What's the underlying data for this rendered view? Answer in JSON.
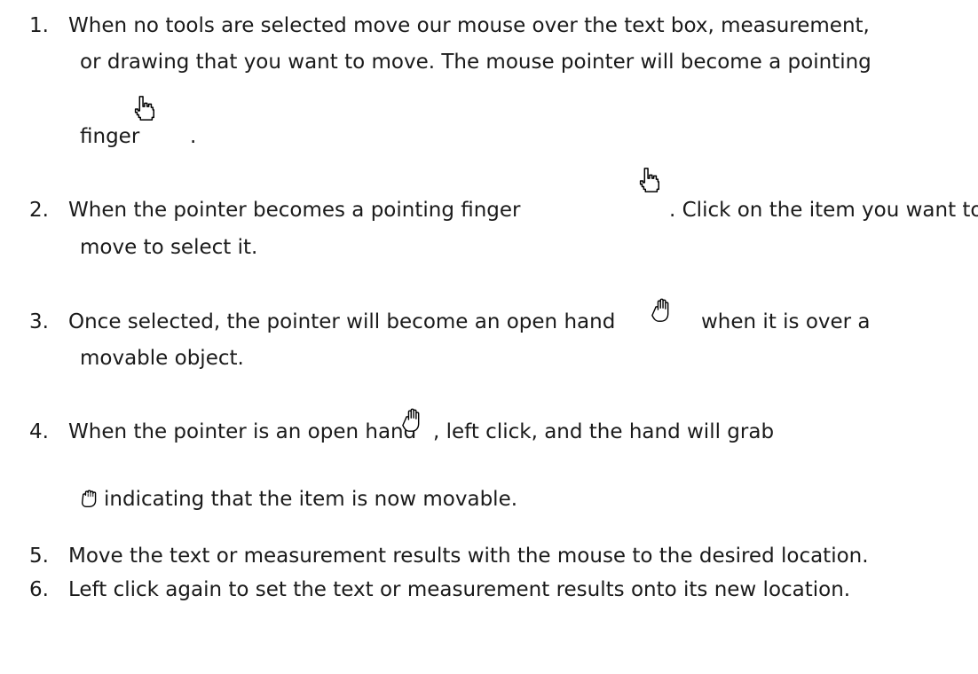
{
  "steps": [
    {
      "number": "1.",
      "lines": [
        "When no tools are selected move our mouse over the text box, measurement,",
        "or drawing that you want to move. The mouse pointer will become a pointing",
        "finger",
        "."
      ],
      "icon": "pointing-finger-icon"
    },
    {
      "number": "2.",
      "lines": [
        "When the pointer becomes a pointing finger",
        ". Click on the item you want to",
        "move to select it."
      ],
      "icon": "pointing-finger-icon"
    },
    {
      "number": "3.",
      "lines": [
        "Once selected, the pointer will become an open hand",
        "when it is over a",
        "movable object."
      ],
      "icon": "open-hand-icon"
    },
    {
      "number": "4.",
      "lines": [
        "When the pointer is an open hand",
        ", left click, and the hand will grab",
        "indicating that the item is now movable."
      ],
      "icons": [
        "open-hand-icon",
        "grab-hand-icon"
      ]
    },
    {
      "number": "5.",
      "lines": [
        "Move the text or measurement results with the mouse to the desired location."
      ]
    },
    {
      "number": "6.",
      "lines": [
        "Left click again to set the text or measurement results onto its new location."
      ]
    }
  ]
}
